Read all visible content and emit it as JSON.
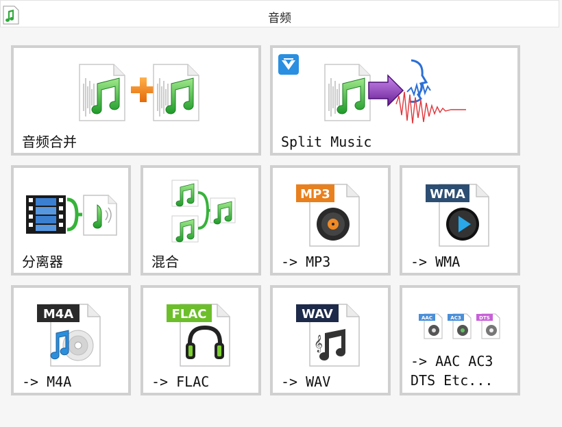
{
  "window": {
    "title": "音频"
  },
  "tiles": [
    {
      "label": "音频合并"
    },
    {
      "label": "Split Music"
    },
    {
      "label": "分离器"
    },
    {
      "label": "混合"
    },
    {
      "label": "-> MP3",
      "badge": "MP3"
    },
    {
      "label": "-> WMA",
      "badge": "WMA"
    },
    {
      "label": "-> M4A",
      "badge": "M4A"
    },
    {
      "label": "-> FLAC",
      "badge": "FLAC"
    },
    {
      "label": "-> WAV",
      "badge": "WAV"
    },
    {
      "label": "-> AAC AC3\nDTS Etc...",
      "mini_badges": [
        "AAC",
        "AC3",
        "DTS"
      ]
    }
  ],
  "colors": {
    "tile_border": "#d0d0d0",
    "music_green": "#3cb83c",
    "mp3_badge": "#e8801e",
    "wma_badge": "#2d4e73",
    "m4a_badge": "#2a2a2a",
    "flac_badge": "#6cbf2a",
    "wav_badge": "#1d2a4a",
    "split_arrow": "#7b2aa8",
    "wave_blue": "#2b6fd6",
    "wave_red": "#e0343a",
    "vip_badge": "#2a8fe0"
  }
}
